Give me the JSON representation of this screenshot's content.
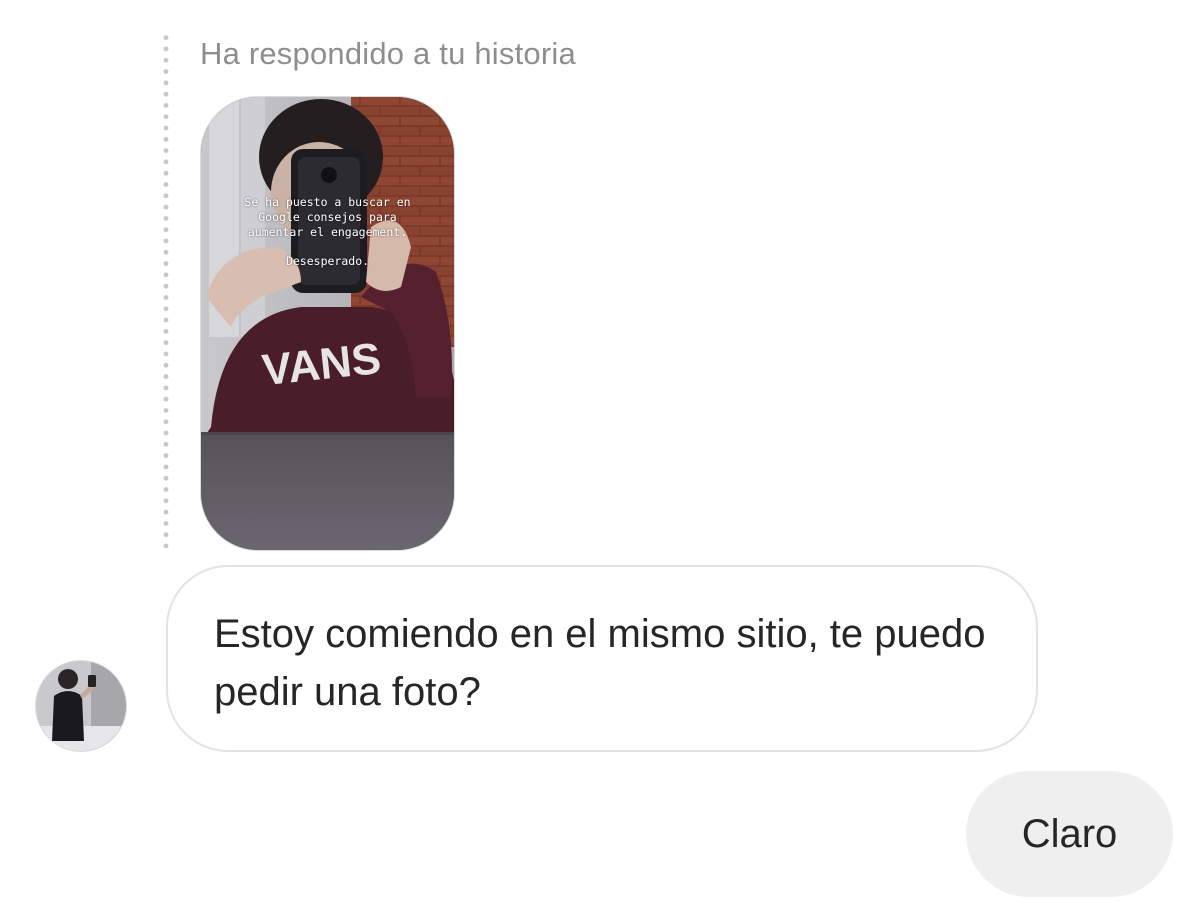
{
  "story_reply": {
    "label": "Ha respondido a tu historia",
    "story_caption": {
      "line1": "Se ha puesto a buscar en",
      "line2": "Google consejos para",
      "line3": "aumentar el engagement.",
      "line4": "Desesperado."
    },
    "shirt_text": "VANS"
  },
  "messages": {
    "incoming": {
      "text": "Estoy comiendo en el mismo sitio, te puedo pedir una foto?"
    },
    "outgoing": {
      "text": "Claro"
    }
  },
  "colors": {
    "label_gray": "#8e8e8e",
    "bubble_border": "#e3e3e3",
    "outgoing_bubble": "#efefef",
    "text": "#262626"
  },
  "icons": {
    "thread_line": "dotted-line",
    "avatar": "user-avatar-photo"
  }
}
